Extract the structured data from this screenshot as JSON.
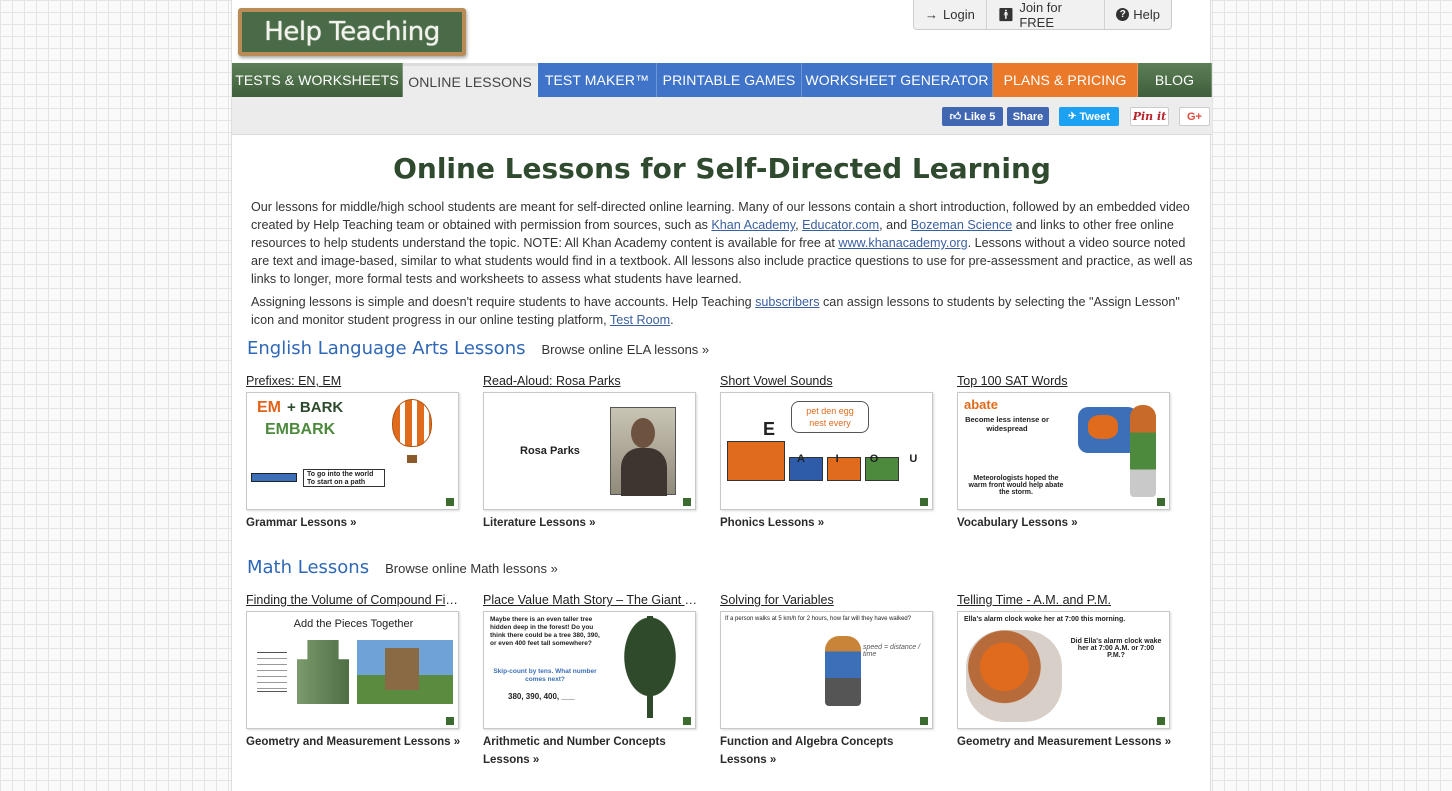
{
  "logo": {
    "text": "Help Teaching"
  },
  "account": {
    "login": "Login",
    "join": "Join for FREE",
    "help": "Help"
  },
  "nav": {
    "tabs": [
      "TESTS & WORKSHEETS",
      "ONLINE LESSONS",
      "TEST MAKER™",
      "PRINTABLE GAMES",
      "WORKSHEET GENERATOR",
      "PLANS & PRICING",
      "BLOG"
    ]
  },
  "social": {
    "like": "Like 5",
    "share": "Share",
    "tweet": "Tweet",
    "pin": "Pin it",
    "gplus": "G+"
  },
  "colors": {
    "green": "#4a6b47",
    "blue": "#3f74c9",
    "orange": "#ea7a2a",
    "title": "#2f4a2e",
    "link": "#2f67b7"
  },
  "page": {
    "title": "Online Lessons for Self-Directed Learning",
    "p1_a": "Our lessons for middle/high school students are meant for self-directed online learning. Many of our lessons contain a short introduction, followed by an embedded video created by Help Teaching team or obtained with permission from sources, such as ",
    "p1_link1": "Khan Academy",
    "p1_b": ", ",
    "p1_link2": "Educator.com",
    "p1_c": ", and ",
    "p1_link3": "Bozeman Science",
    "p1_d": " and links to other free online resources to help students understand the topic. NOTE: All Khan Academy content is available for free at ",
    "p1_link4": "www.khanacademy.org",
    "p1_e": ". Lessons without a video source noted are text and image-based, similar to what students would find in a textbook. All lessons also include practice questions to use for pre-assessment and practice, as well as links to longer, more formal tests and worksheets to assess what students have learned.",
    "p2_a": "Assigning lessons is simple and doesn't require students to have accounts. Help Teaching ",
    "p2_link1": "subscribers",
    "p2_b": " can assign lessons to students by selecting the \"Assign Lesson\" icon and monitor student progress in our online testing platform, ",
    "p2_link2": "Test Room",
    "p2_c": "."
  },
  "ela": {
    "title": "English Language Arts Lessons",
    "browse": "Browse online ELA lessons »",
    "cards": [
      {
        "title": "Prefixes: EN, EM",
        "category": "Grammar Lessons »",
        "t1": "EM",
        "t2": "+ BARK",
        "t3": "EMBARK",
        "t4": "To go into the world",
        "t5": "To start on a path"
      },
      {
        "title": "Read-Aloud: Rosa Parks",
        "category": "Literature Lessons »",
        "t1": "Rosa Parks"
      },
      {
        "title": "Short Vowel Sounds",
        "category": "Phonics Lessons »",
        "t1": "pet  den  egg",
        "t2": "nest  every",
        "t3": "E",
        "t4": "A  I  O  U"
      },
      {
        "title": "Top 100 SAT Words",
        "category": "Vocabulary Lessons »",
        "t1": "abate",
        "t2": "Become less intense or widespread",
        "t3": "Meteorologists hoped the warm front would help abate the storm."
      }
    ]
  },
  "math": {
    "title": "Math Lessons",
    "browse": "Browse online Math lessons »",
    "cards": [
      {
        "title": "Finding the Volume of Compound Figures",
        "category": "Geometry and Measurement Lessons »",
        "t1": "Add the Pieces Together"
      },
      {
        "title": "Place Value Math Story – The Giant Tree",
        "category": "Arithmetic and Number Concepts Lessons »",
        "t1": "Maybe there is an even taller tree hidden deep in the forest! Do you think there could be a tree 380, 390, or even 400 feet tall somewhere?",
        "t2": "Skip-count by tens. What number comes next?",
        "t3": "380, 390, 400, ___"
      },
      {
        "title": "Solving for Variables",
        "category": "Function and Algebra Concepts Lessons »",
        "t1": "If a person walks at 5 km/h for 2 hours, how far will they have walked?",
        "t2": "speed = distance / time"
      },
      {
        "title": "Telling Time - A.M. and P.M.",
        "category": "Geometry and Measurement Lessons »",
        "t1": "Ella's alarm clock woke her at 7:00 this morning.",
        "t2": "Did Ella's alarm clock wake her at 7:00 A.M. or 7:00 P.M.?"
      }
    ]
  }
}
